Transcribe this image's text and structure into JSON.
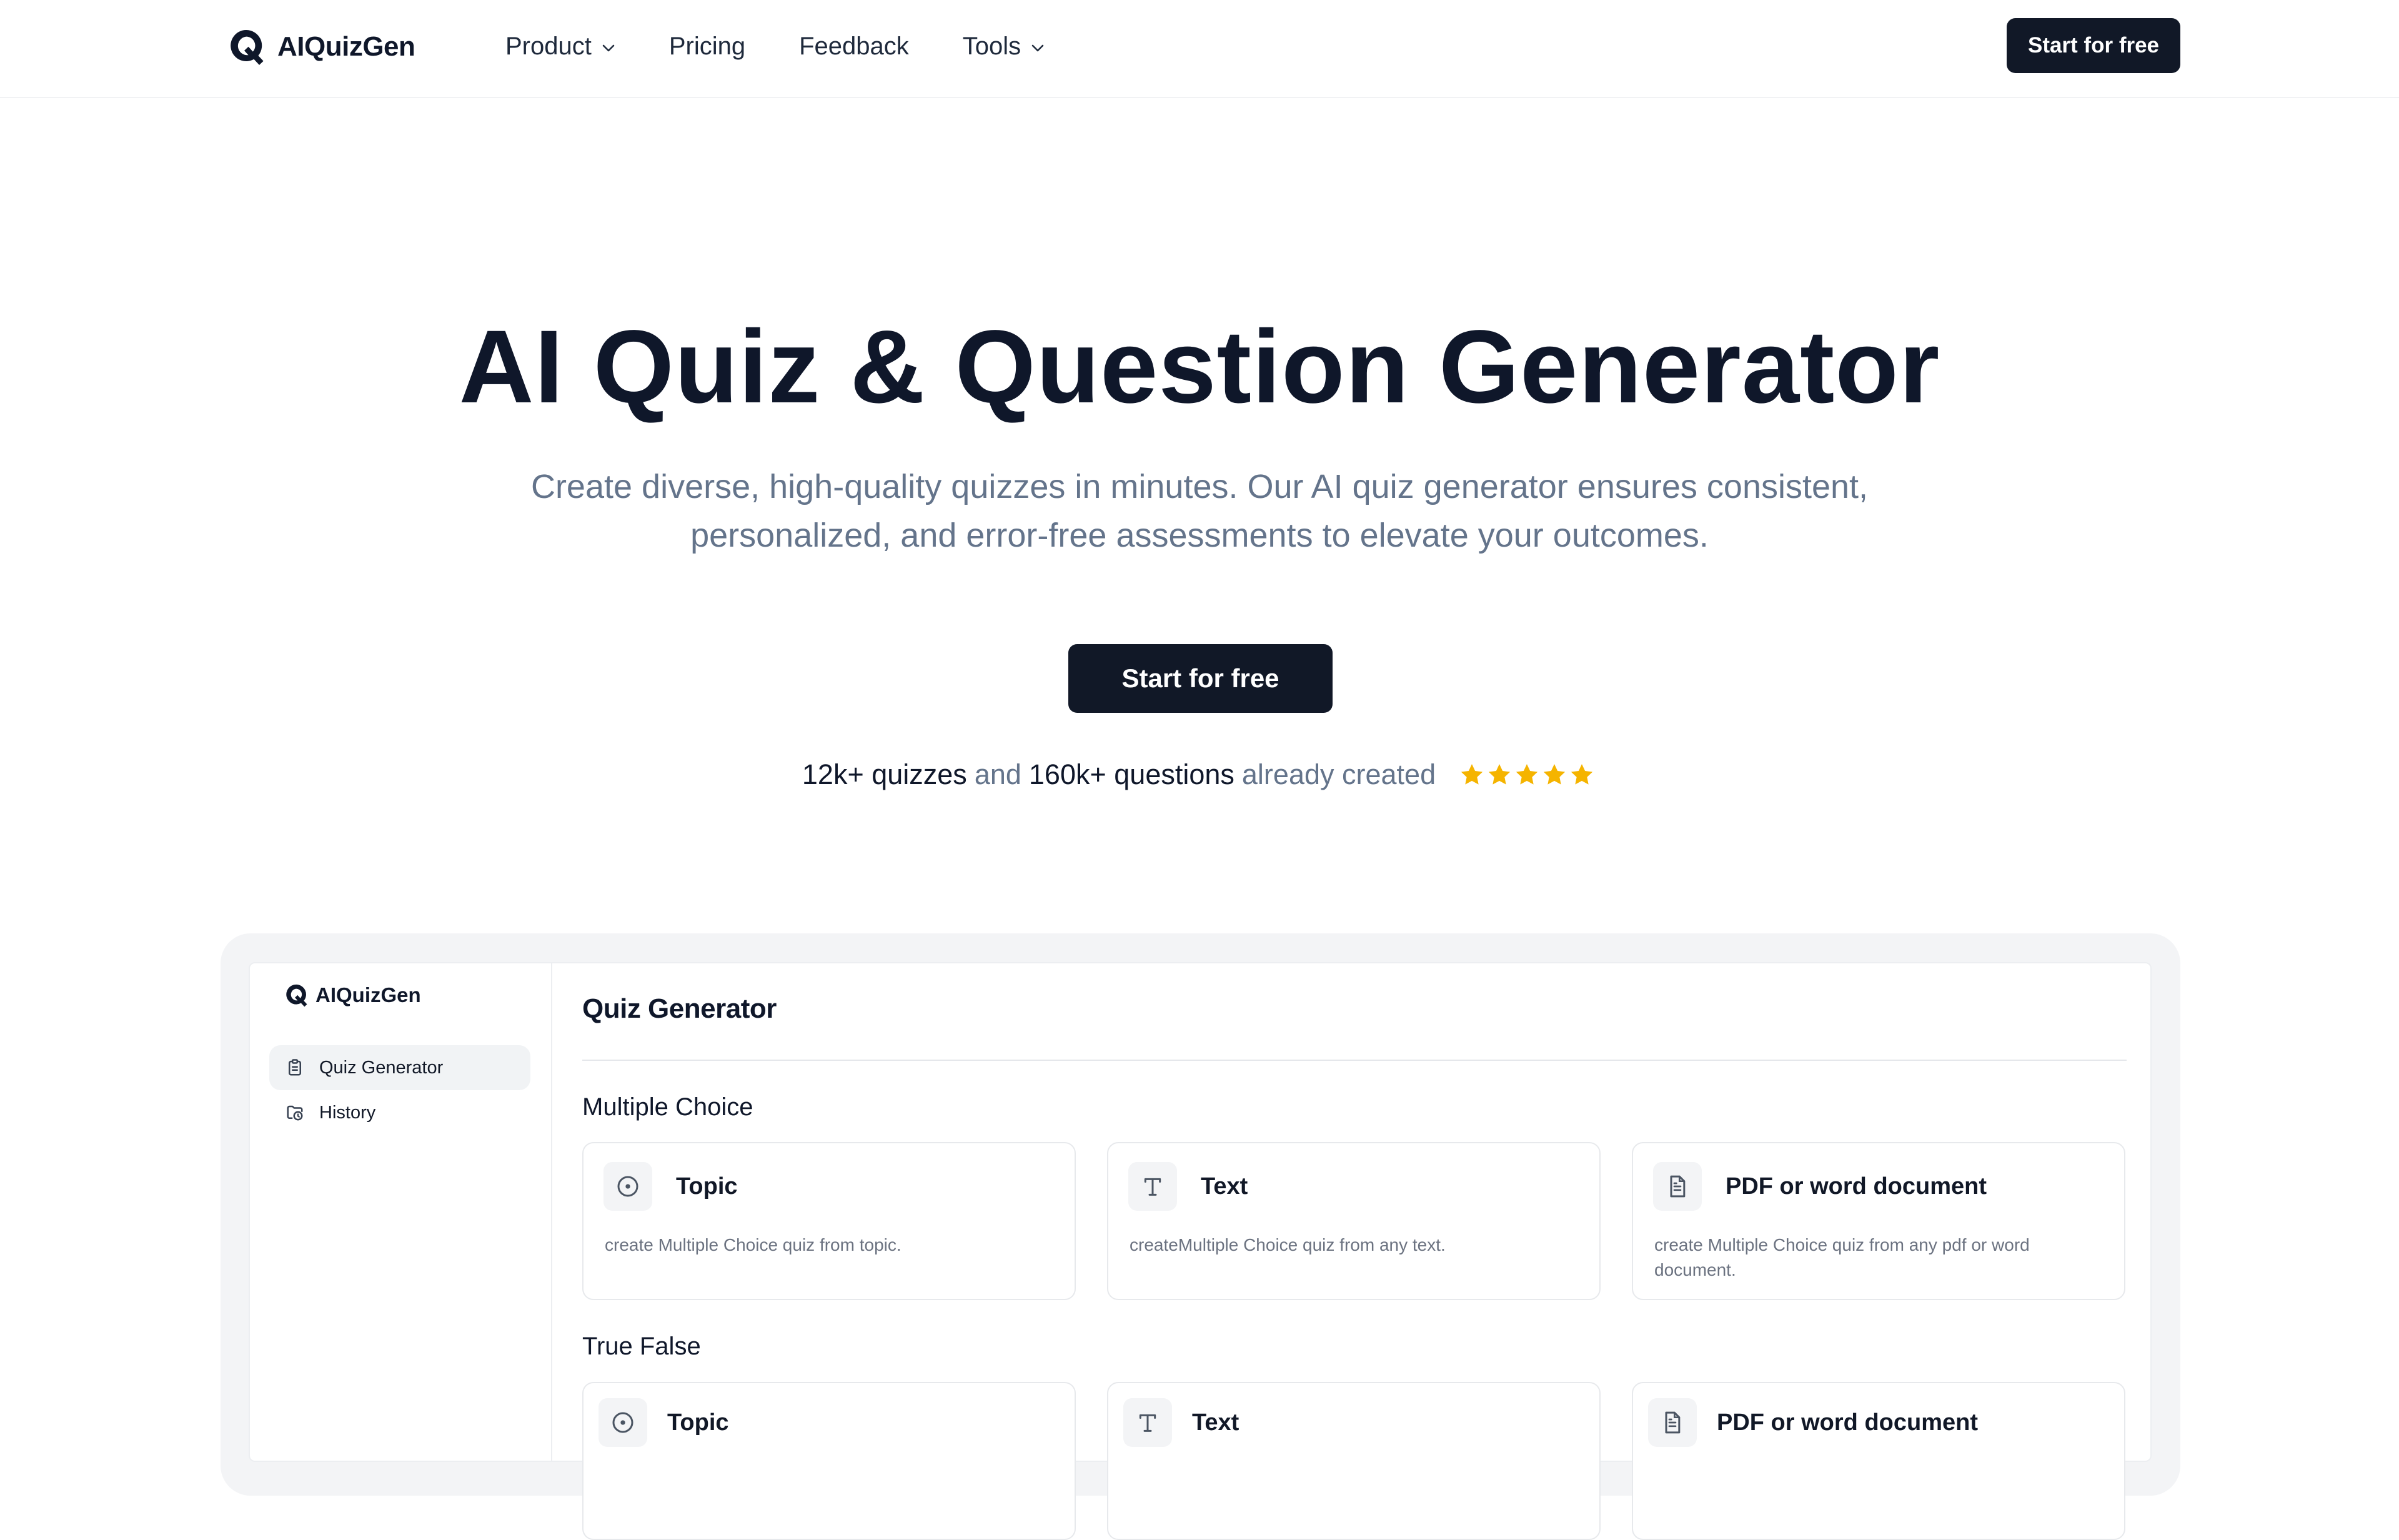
{
  "nav": {
    "brand": "AIQuizGen",
    "links": [
      {
        "label": "Product",
        "has_dropdown": true
      },
      {
        "label": "Pricing",
        "has_dropdown": false
      },
      {
        "label": "Feedback",
        "has_dropdown": false
      },
      {
        "label": "Tools",
        "has_dropdown": true
      }
    ],
    "cta": "Start for free"
  },
  "hero": {
    "title": "AI Quiz & Question Generator",
    "subtitle_line1": "Create diverse, high-quality quizzes in minutes. Our AI quiz generator ensures consistent,",
    "subtitle_line2": "personalized, and error-free assessments to elevate your outcomes.",
    "cta": "Start for free",
    "stats": {
      "quizzes": "12k+ quizzes",
      "and": "and",
      "questions": "160k+ questions",
      "suffix": "already created",
      "rating_stars": 5
    }
  },
  "preview": {
    "brand": "AIQuizGen",
    "sidebar": [
      {
        "label": "Quiz Generator",
        "icon": "clipboard-icon",
        "active": true
      },
      {
        "label": "History",
        "icon": "folder-clock-icon",
        "active": false
      }
    ],
    "title": "Quiz Generator",
    "sections": [
      {
        "label": "Multiple Choice",
        "cards": [
          {
            "title": "Topic",
            "icon": "target-icon",
            "desc": "create Multiple Choice quiz from topic."
          },
          {
            "title": "Text",
            "icon": "text-icon",
            "desc": "createMultiple Choice quiz from any text."
          },
          {
            "title": "PDF or word document",
            "icon": "document-icon",
            "desc": "create Multiple Choice quiz from any pdf or word document."
          }
        ]
      },
      {
        "label": "True False",
        "cards": [
          {
            "title": "Topic",
            "icon": "target-icon",
            "desc": ""
          },
          {
            "title": "Text",
            "icon": "text-icon",
            "desc": ""
          },
          {
            "title": "PDF or word document",
            "icon": "document-icon",
            "desc": ""
          }
        ]
      }
    ]
  },
  "colors": {
    "primary_dark": "#111827",
    "heading": "#0f172a",
    "muted": "#64748b",
    "star": "#f5b400",
    "frame_bg": "#f3f4f6"
  }
}
